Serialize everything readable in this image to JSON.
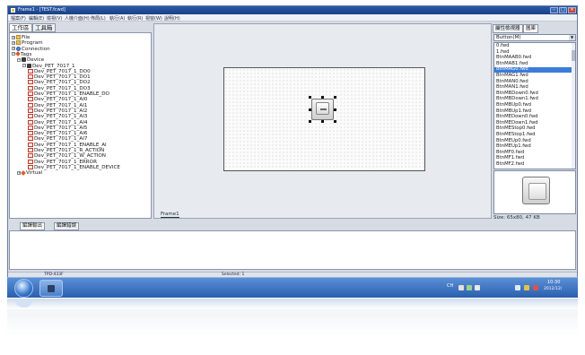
{
  "window": {
    "title": "Frame1 - [TEST.fcwd]",
    "min_icon": "minimize-icon",
    "max_icon": "maximize-icon",
    "close_icon": "close-icon"
  },
  "menu": [
    "檔案(F)",
    "編輯(E)",
    "檢視(V)",
    "人機介面(H)",
    "佈局(L)",
    "執行(A)",
    "執行(R)",
    "視窗(W)",
    "說明(H)"
  ],
  "left_panel": {
    "tabs": [
      "工作區",
      "工具箱"
    ],
    "tree": [
      {
        "label": "File",
        "icon": "folder-icon",
        "indent": 0
      },
      {
        "label": "Program",
        "icon": "folder-icon",
        "indent": 0
      },
      {
        "label": "Connection",
        "icon": "globe-icon",
        "indent": 0
      },
      {
        "label": "Tags",
        "icon": "tag-icon",
        "indent": 0
      },
      {
        "label": "Device",
        "icon": "device-icon",
        "indent": 1
      },
      {
        "label": "Dev_PET_7017_1",
        "icon": "device-icon",
        "indent": 2
      },
      {
        "label": "Dev_PET_7017_1_DO0",
        "icon": "variable-icon",
        "indent": 3
      },
      {
        "label": "Dev_PET_7017_1_DO1",
        "icon": "variable-icon",
        "indent": 3
      },
      {
        "label": "Dev_PET_7017_1_DO2",
        "icon": "variable-icon",
        "indent": 3
      },
      {
        "label": "Dev_PET_7017_1_DO3",
        "icon": "variable-icon",
        "indent": 3
      },
      {
        "label": "Dev_PET_7017_1_ENABLE_DO",
        "icon": "variable-icon",
        "indent": 3
      },
      {
        "label": "Dev_PET_7017_1_AI0",
        "icon": "variable-icon",
        "indent": 3
      },
      {
        "label": "Dev_PET_7017_1_AI1",
        "icon": "variable-icon",
        "indent": 3
      },
      {
        "label": "Dev_PET_7017_1_AI2",
        "icon": "variable-icon",
        "indent": 3
      },
      {
        "label": "Dev_PET_7017_1_AI3",
        "icon": "variable-icon",
        "indent": 3
      },
      {
        "label": "Dev_PET_7017_1_AI4",
        "icon": "variable-icon",
        "indent": 3
      },
      {
        "label": "Dev_PET_7017_1_AI5",
        "icon": "variable-icon",
        "indent": 3
      },
      {
        "label": "Dev_PET_7017_1_AI6",
        "icon": "variable-icon",
        "indent": 3
      },
      {
        "label": "Dev_PET_7017_1_AI7",
        "icon": "variable-icon",
        "indent": 3
      },
      {
        "label": "Dev_PET_7017_1_ENABLE_AI",
        "icon": "variable-icon",
        "indent": 3
      },
      {
        "label": "Dev_PET_7017_1_R_ACTION",
        "icon": "variable-icon",
        "indent": 3
      },
      {
        "label": "Dev_PET_7017_1_W_ACTION",
        "icon": "variable-icon",
        "indent": 3
      },
      {
        "label": "Dev_PET_7017_1_ERROR",
        "icon": "variable-icon",
        "indent": 3
      },
      {
        "label": "Dev_PET_7017_1_ENABLE_DEVICE",
        "icon": "variable-icon",
        "indent": 3
      },
      {
        "label": "Virtual",
        "icon": "virtual-icon",
        "indent": 1
      }
    ]
  },
  "canvas": {
    "frame_tab": "Frame1"
  },
  "right_panel": {
    "tabs": [
      "屬性檢視器",
      "圖庫"
    ],
    "category": "Button(M)",
    "items": [
      "0.fwd",
      "1.fwd",
      "BtnMAAB0.fwd",
      "BtnMAB1.fwd",
      "BtnMAG0.fwd",
      "BtnMAG1.fwd",
      "BtnMAN0.fwd",
      "BtnMAN1.fwd",
      "BtnMBDown0.fwd",
      "BtnMBDown1.fwd",
      "BtnMBUp0.fwd",
      "BtnMBUp1.fwd",
      "BtnMEDown0.fwd",
      "BtnMEDown1.fwd",
      "BtnMEStop0.fwd",
      "BtnMEStop1.fwd",
      "BtnMEUp0.fwd",
      "BtnMEUp1.fwd",
      "BtnMF0.fwd",
      "BtnMF1.fwd",
      "BtnMF2.fwd"
    ],
    "selected_index": 4,
    "size_label": "Size: 65x80, 47 KB"
  },
  "bottom": {
    "tabs": [
      "編譯輸出",
      "編譯錯誤"
    ]
  },
  "status": {
    "left": "TPD-433F",
    "center": "Selected: 1"
  },
  "taskbar": {
    "tray_text": "CH",
    "time": "10:30",
    "date": "2012/12/"
  },
  "colors": {
    "titlebar": "#1b3f86",
    "selection": "#3d7bd8",
    "taskbar": "#2a5fae"
  }
}
